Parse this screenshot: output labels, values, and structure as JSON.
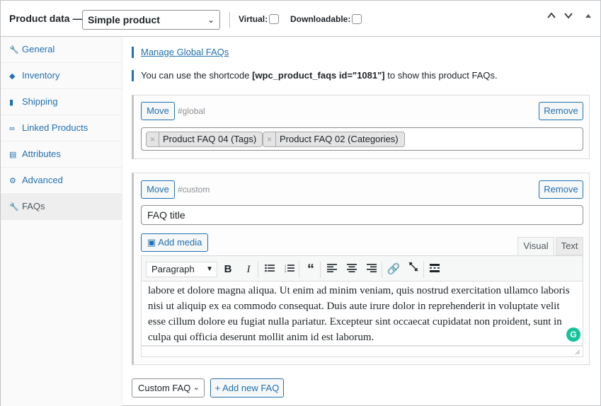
{
  "header": {
    "title": "Product data —",
    "product_type": "Simple product",
    "virtual_label": "Virtual:",
    "downloadable_label": "Downloadable:",
    "virtual_checked": false,
    "downloadable_checked": false
  },
  "sidebar": {
    "items": [
      {
        "label": "General",
        "icon": "wrench-icon"
      },
      {
        "label": "Inventory",
        "icon": "tag-icon"
      },
      {
        "label": "Shipping",
        "icon": "truck-icon"
      },
      {
        "label": "Linked Products",
        "icon": "link-icon"
      },
      {
        "label": "Attributes",
        "icon": "list-icon"
      },
      {
        "label": "Advanced",
        "icon": "gear-icon"
      },
      {
        "label": "FAQs",
        "icon": "wrench-icon"
      }
    ],
    "active": "FAQs"
  },
  "main": {
    "manage_link": "Manage Global FAQs",
    "shortcode_prefix": "You can use the shortcode ",
    "shortcode": "[wpc_product_faqs id=\"1081\"]",
    "shortcode_suffix": " to show this product FAQs.",
    "global_block": {
      "move_label": "Move",
      "hash": "#global",
      "remove_label": "Remove",
      "tags": [
        "Product FAQ 04 (Tags)",
        "Product FAQ 02 (Categories)"
      ]
    },
    "custom_block": {
      "move_label": "Move",
      "hash": "#custom",
      "remove_label": "Remove",
      "title_value": "FAQ title",
      "add_media_label": "Add media",
      "tab_visual": "Visual",
      "tab_text": "Text",
      "format_select": "Paragraph",
      "content": "labore et dolore magna aliqua. Ut enim ad minim veniam, quis nostrud exercitation ullamco laboris nisi ut aliquip ex ea commodo consequat. Duis aute irure dolor in reprehenderit in voluptate velit esse cillum dolore eu fugiat nulla pariatur. Excepteur sint occaecat cupidatat non proident, sunt in culpa qui officia deserunt mollit anim id est laborum."
    },
    "footer": {
      "faq_type_select": "Custom FAQ",
      "add_button": "+ Add new FAQ"
    }
  },
  "colors": {
    "accent": "#2271b1",
    "border": "#c3c4c7",
    "grammarly": "#15c39a"
  }
}
